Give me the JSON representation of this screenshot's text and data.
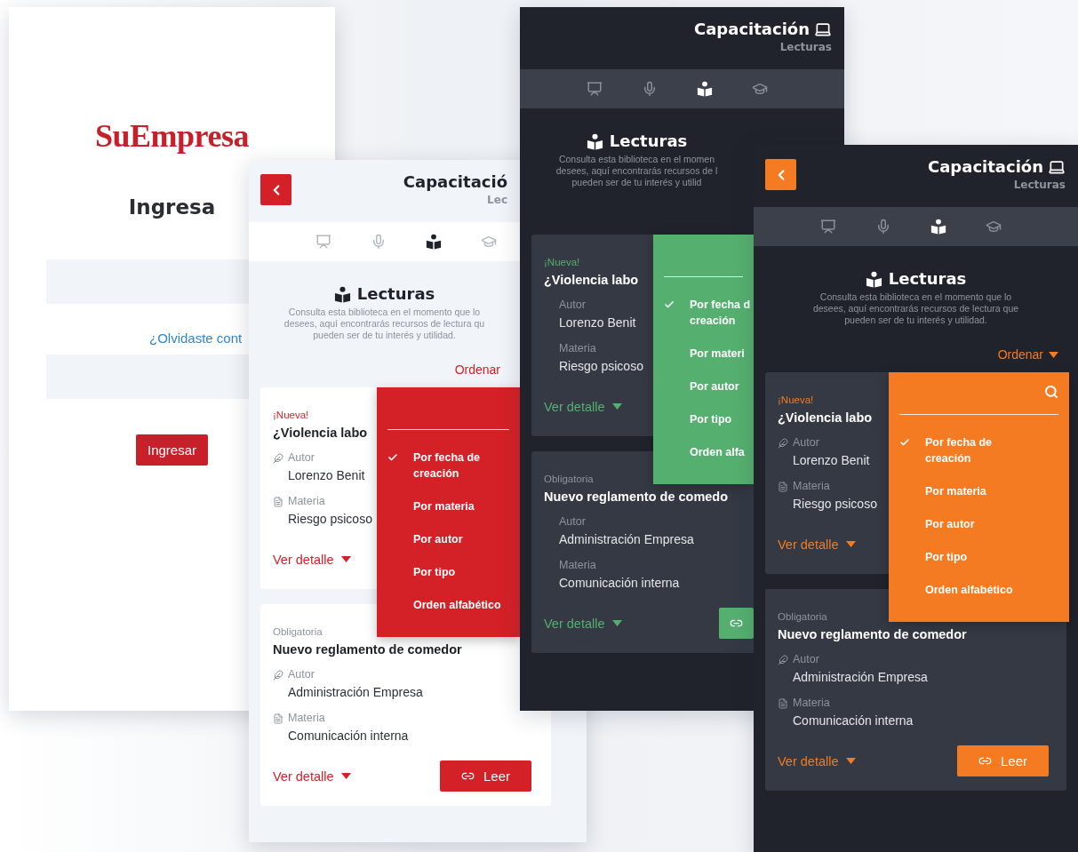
{
  "screens": [
    {
      "kind": "login",
      "color": "#c8202a",
      "logo": "SuEmpresa",
      "heading": "Ingresa",
      "forgot_link": "¿Olvidaste cont",
      "submit": "Ingresar"
    },
    {
      "kind": "library",
      "dark": false,
      "color": "#d42127",
      "back_button": true,
      "title": "Capacitació",
      "subtitle": "Lec",
      "tabs": [
        {
          "kind": "presentation",
          "selected": false
        },
        {
          "kind": "microphone",
          "selected": false
        },
        {
          "kind": "reading",
          "selected": true
        },
        {
          "kind": "graduation",
          "selected": false
        }
      ],
      "heading": "Lecturas",
      "description": "Consulta esta biblioteca en el momento que lo\ndesees, aquí encontrarás recursos de lectura qu\npueden ser de tu interés y utilidad.",
      "sort_label": "Ordenar",
      "sort_menu": {
        "options": [
          {
            "label": "Por fecha de creación",
            "selected": true
          },
          {
            "label": "Por materia",
            "selected": false
          },
          {
            "label": "Por autor",
            "selected": false
          },
          {
            "label": "Por tipo",
            "selected": false
          },
          {
            "label": "Orden alfabético",
            "selected": false
          }
        ]
      },
      "cards": [
        {
          "kind": "new",
          "tag": "¡Nueva!",
          "title": "¿Violencia labo",
          "fields": [
            {
              "kind": "author",
              "label": "Autor",
              "value": "Lorenzo Benit"
            },
            {
              "kind": "subject",
              "label": "Materia",
              "value": "Riesgo psicoso"
            }
          ],
          "detail_link": "Ver detalle"
        },
        {
          "kind": "required",
          "tag": "Obligatoria",
          "title": "Nuevo reglamento de comedor",
          "fields": [
            {
              "kind": "author",
              "label": "Autor",
              "value": "Administración Empresa"
            },
            {
              "kind": "subject",
              "label": "Materia",
              "value": "Comunicación interna"
            }
          ],
          "detail_link": "Ver detalle",
          "action": {
            "kind": "link",
            "label": "Leer"
          }
        }
      ]
    },
    {
      "kind": "library",
      "dark": true,
      "color": "#55b06f",
      "title": "Capacitación",
      "title_icon": true,
      "subtitle": "Lecturas",
      "tabs": [
        {
          "kind": "presentation",
          "selected": false
        },
        {
          "kind": "microphone",
          "selected": false
        },
        {
          "kind": "reading",
          "selected": true
        },
        {
          "kind": "graduation",
          "selected": false
        }
      ],
      "heading": "Lecturas",
      "description": "Consulta esta biblioteca en el momen\ndesees, aquí encontrarás recursos de l\npueden ser de tu interés y utilid",
      "sort_menu": {
        "options": [
          {
            "label": "Por fecha d creación",
            "selected": true
          },
          {
            "label": "Por materi",
            "selected": false
          },
          {
            "label": "Por autor",
            "selected": false
          },
          {
            "label": "Por tipo",
            "selected": false
          },
          {
            "label": "Orden alfa",
            "selected": false
          }
        ]
      },
      "cards": [
        {
          "kind": "new",
          "tag": "¡Nueva!",
          "title": "¿Violencia labo",
          "fields": [
            {
              "label": "Autor",
              "value": "Lorenzo Benit"
            },
            {
              "label": "Materia",
              "value": "Riesgo psicoso"
            }
          ],
          "detail_link": "Ver detalle"
        },
        {
          "kind": "required",
          "tag": "Obligatoria",
          "title": "Nuevo reglamento de comedo",
          "fields": [
            {
              "label": "Autor",
              "value": "Administración Empresa"
            },
            {
              "label": "Materia",
              "value": "Comunicación interna"
            }
          ],
          "detail_link": "Ver detalle",
          "action": {
            "kind": "link"
          }
        }
      ]
    },
    {
      "kind": "library",
      "dark": true,
      "color": "#f47b22",
      "back_button": true,
      "title": "Capacitación",
      "title_icon": true,
      "subtitle": "Lecturas",
      "tabs": [
        {
          "kind": "presentation",
          "selected": false
        },
        {
          "kind": "microphone",
          "selected": false
        },
        {
          "kind": "reading",
          "selected": true
        },
        {
          "kind": "graduation",
          "selected": false
        }
      ],
      "heading": "Lecturas",
      "description": "Consulta esta biblioteca en el momento que lo\ndesees, aquí encontrarás recursos de lectura que\npueden ser de tu interés y utilidad.",
      "sort_label": "Ordenar",
      "sort_caret": true,
      "sort_menu": {
        "search_icon": true,
        "options": [
          {
            "label": "Por fecha de creación",
            "selected": true
          },
          {
            "label": "Por materia",
            "selected": false
          },
          {
            "label": "Por autor",
            "selected": false
          },
          {
            "label": "Por tipo",
            "selected": false
          },
          {
            "label": "Orden alfabético",
            "selected": false
          }
        ]
      },
      "cards": [
        {
          "kind": "new",
          "tag": "¡Nueva!",
          "title": "¿Violencia labo",
          "fields": [
            {
              "kind": "author",
              "label": "Autor",
              "value": "Lorenzo Benit"
            },
            {
              "kind": "subject",
              "label": "Materia",
              "value": "Riesgo psicoso"
            }
          ],
          "detail_link": "Ver detalle"
        },
        {
          "kind": "required",
          "tag": "Obligatoria",
          "title": "Nuevo reglamento de comedor",
          "fields": [
            {
              "kind": "author",
              "label": "Autor",
              "value": "Administración Empresa"
            },
            {
              "kind": "subject",
              "label": "Materia",
              "value": "Comunicación interna"
            }
          ],
          "detail_link": "Ver detalle",
          "action": {
            "kind": "link",
            "label": "Leer"
          }
        }
      ]
    }
  ]
}
